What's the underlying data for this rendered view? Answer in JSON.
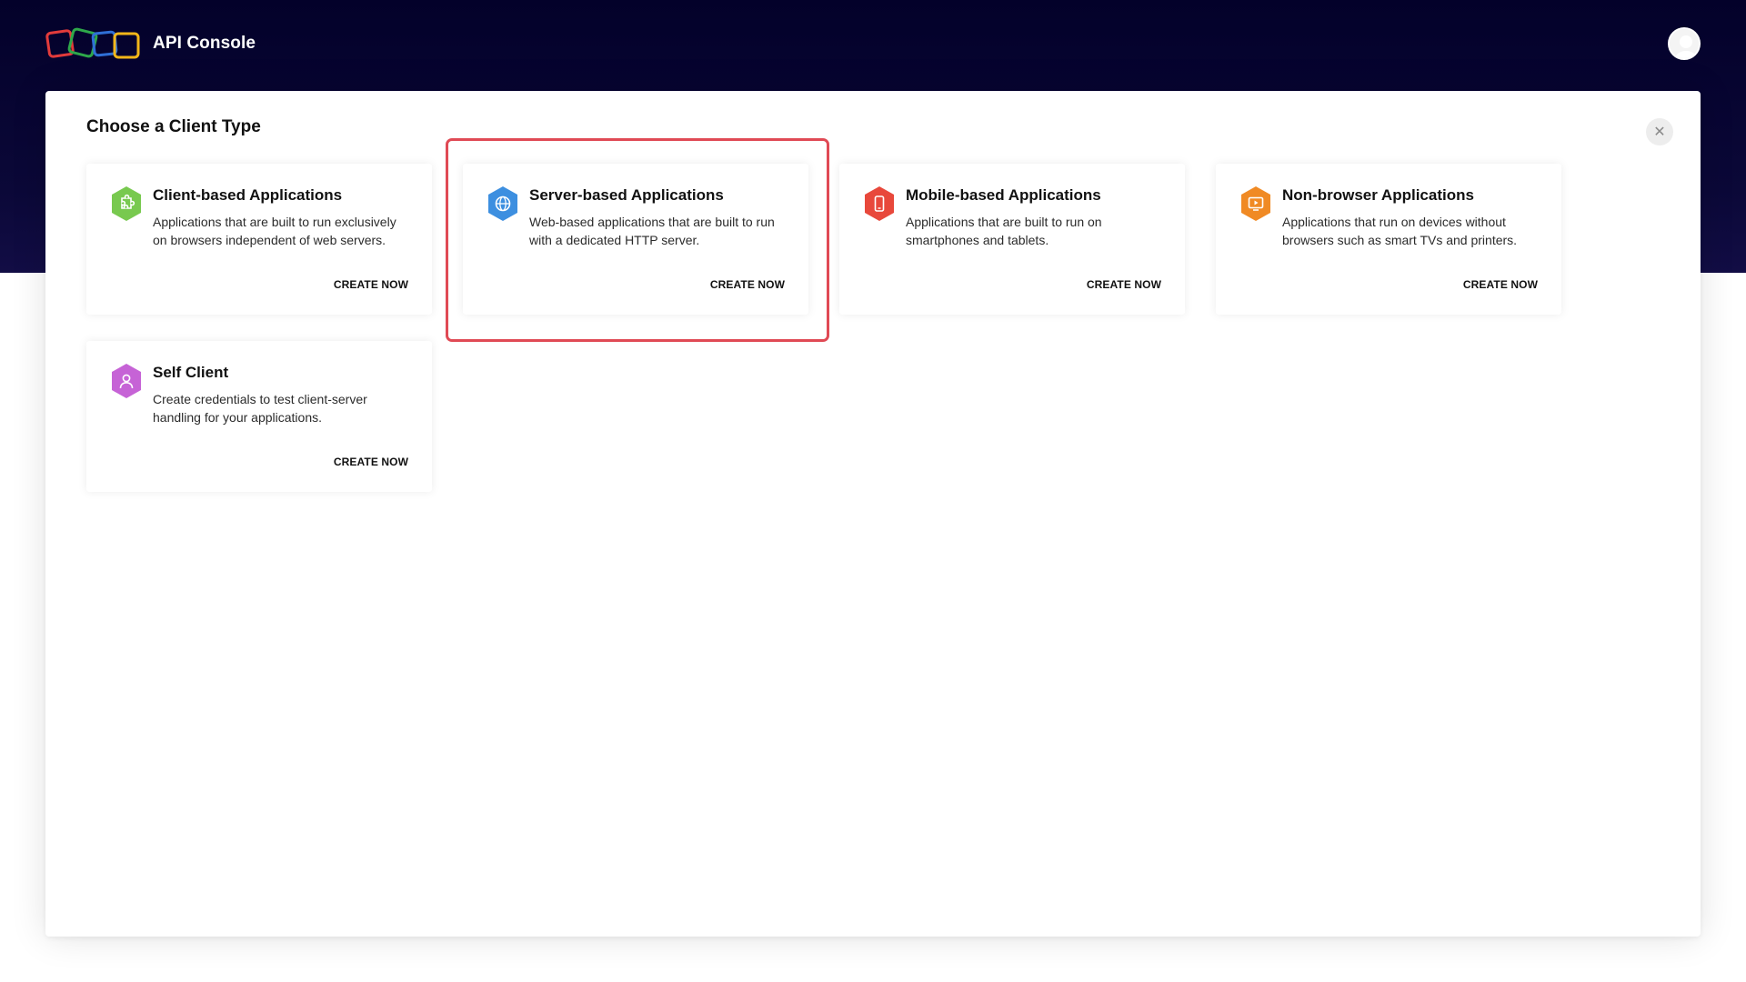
{
  "header": {
    "app_title": "API Console",
    "logo_colors": [
      "#e23b3b",
      "#2ea84a",
      "#2f6fd6",
      "#f2b619"
    ]
  },
  "dialog": {
    "title": "Choose a Client Type",
    "close_icon": "close-icon"
  },
  "cards": [
    {
      "title": "Client-based Applications",
      "description": "Applications that are built to run exclusively on browsers independent of web servers.",
      "action": "CREATE NOW",
      "icon": "puzzle-icon",
      "color": "#78c94f"
    },
    {
      "title": "Server-based Applications",
      "description": "Web-based applications that are built to run with a dedicated HTTP server.",
      "action": "CREATE NOW",
      "icon": "globe-icon",
      "color": "#3d8fe0"
    },
    {
      "title": "Mobile-based Applications",
      "description": "Applications that are built to run on smartphones and tablets.",
      "action": "CREATE NOW",
      "icon": "smartphone-icon",
      "color": "#e8483b"
    },
    {
      "title": "Non-browser Applications",
      "description": "Applications that run on devices without browsers such as smart TVs and printers.",
      "action": "CREATE NOW",
      "icon": "monitor-icon",
      "color": "#f08a24"
    },
    {
      "title": "Self Client",
      "description": "Create credentials to test client-server handling for your applications.",
      "action": "CREATE NOW",
      "icon": "user-icon",
      "color": "#c663d6"
    }
  ],
  "highlight_color": "#e04a55"
}
